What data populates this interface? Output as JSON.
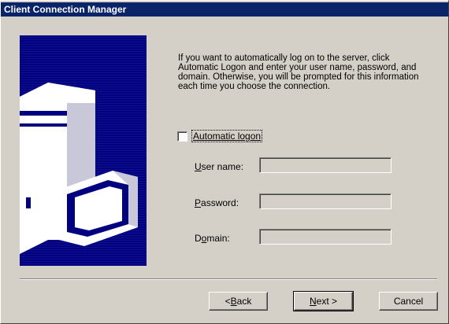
{
  "window": {
    "title": "Client Connection Manager"
  },
  "intro_text": "If you want to automatically log on to the server, click Automatic Logon and enter your user name, password, and domain. Otherwise, you will be prompted for this information each time you choose the connection.",
  "auto_logon": {
    "label": "Automatic logon",
    "checked": false
  },
  "fields": {
    "username": {
      "label_pre": "",
      "label_key": "U",
      "label_post": "ser name:",
      "value": ""
    },
    "password": {
      "label_pre": "",
      "label_key": "P",
      "label_post": "assword:",
      "value": ""
    },
    "domain": {
      "label_pre": "D",
      "label_key": "o",
      "label_post": "main:",
      "value": ""
    }
  },
  "buttons": {
    "back": {
      "prefix": "< ",
      "key": "B",
      "rest": "ack"
    },
    "next": {
      "prefix": "",
      "key": "N",
      "rest": "ext >"
    },
    "cancel": {
      "label": "Cancel"
    }
  },
  "colors": {
    "title_bar": "#0a246a",
    "panel_bg": "#000080",
    "face": "#d4d0c8"
  },
  "icons": {
    "illustration": "computer-monitor-illustration"
  }
}
